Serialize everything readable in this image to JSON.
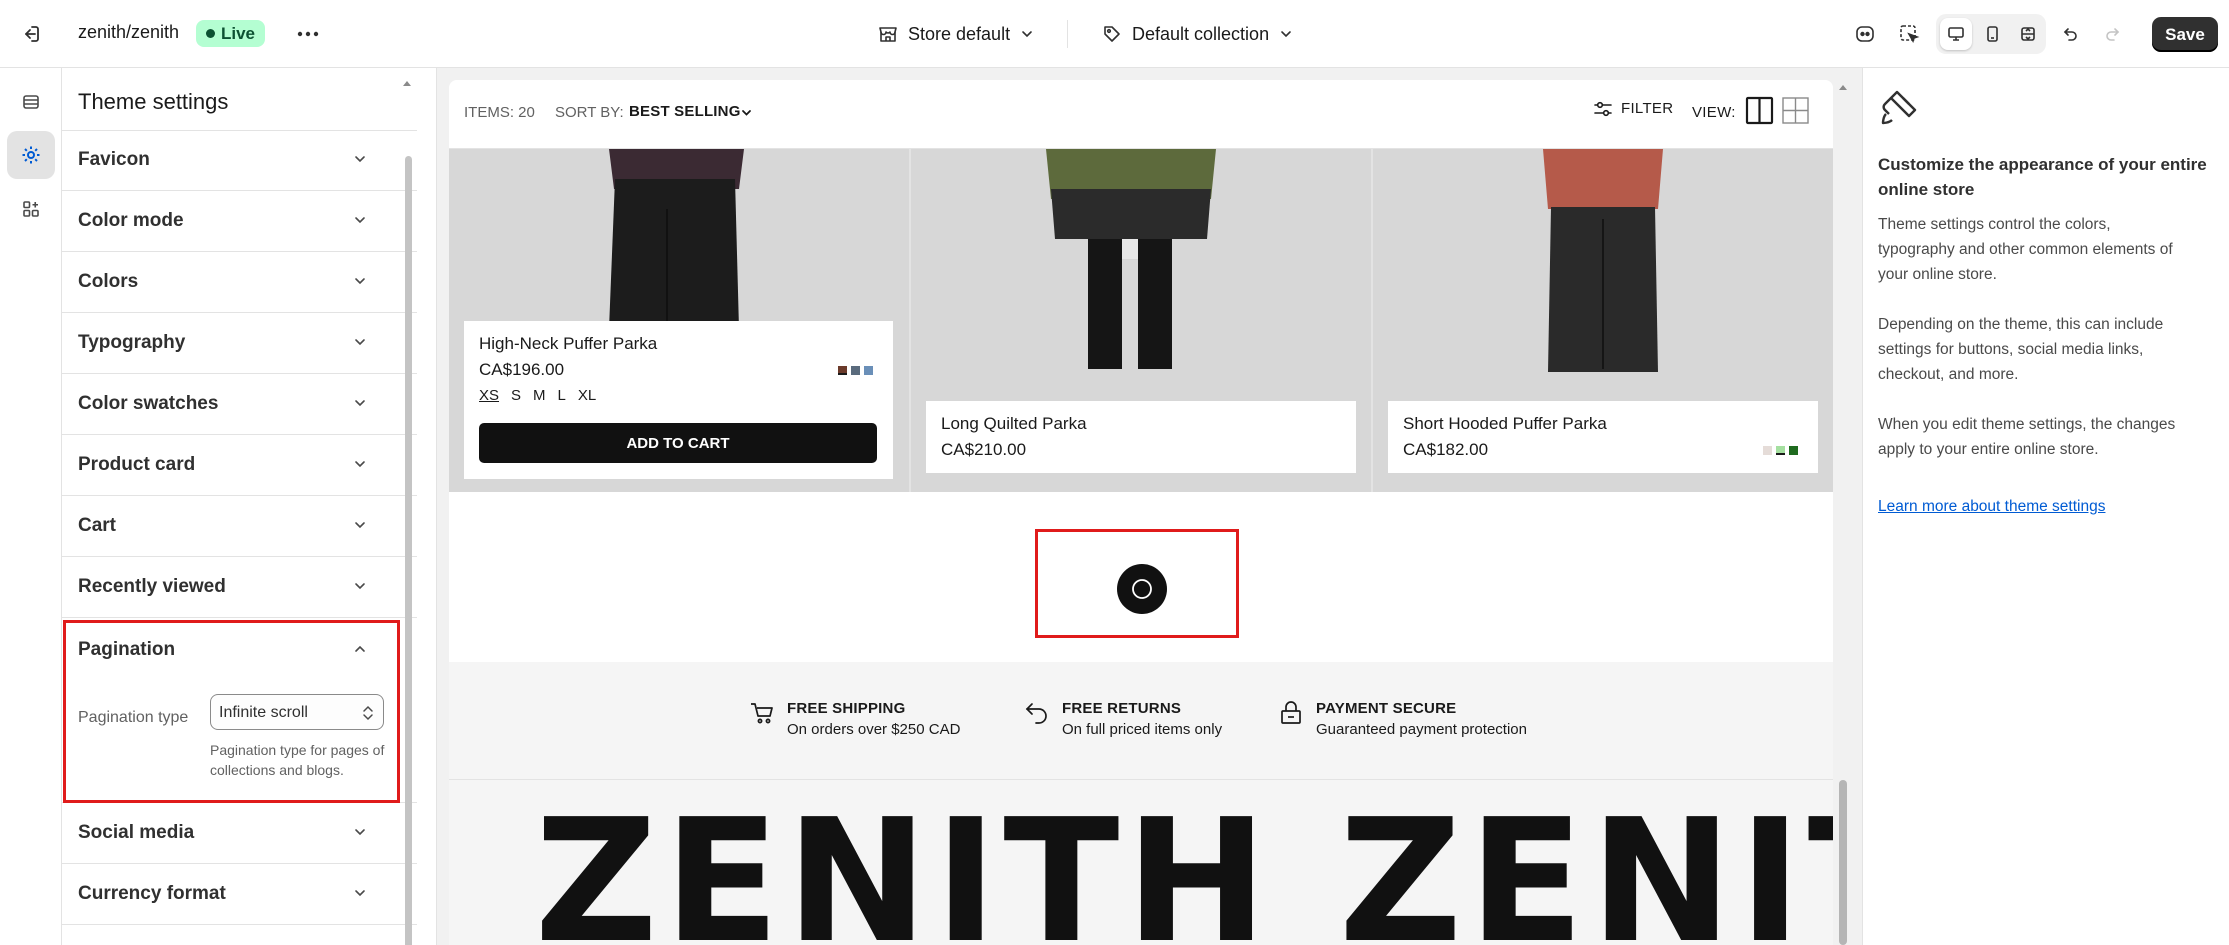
{
  "topbar": {
    "store_name": "zenith/zenith",
    "live_label": "Live",
    "store_select": "Store default",
    "collection_select": "Default collection",
    "save_label": "Save"
  },
  "settings": {
    "title": "Theme settings",
    "sections": [
      {
        "label": "Favicon"
      },
      {
        "label": "Color mode"
      },
      {
        "label": "Colors"
      },
      {
        "label": "Typography"
      },
      {
        "label": "Color swatches"
      },
      {
        "label": "Product card"
      },
      {
        "label": "Cart"
      },
      {
        "label": "Recently viewed"
      }
    ],
    "pagination": {
      "label": "Pagination",
      "type_label": "Pagination type",
      "type_value": "Infinite scroll",
      "help": "Pagination type for pages of collections and blogs."
    },
    "sections_after": [
      {
        "label": "Social media"
      },
      {
        "label": "Currency format"
      }
    ]
  },
  "preview": {
    "toolbar": {
      "items": "ITEMS: 20",
      "sort_label": "SORT BY:",
      "sort_value": "BEST SELLING",
      "filter": "FILTER",
      "view": "VIEW:"
    },
    "products": [
      {
        "name": "High-Neck Puffer Parka",
        "price": "CA$196.00",
        "sizes": [
          "XS",
          "S",
          "M",
          "L",
          "XL"
        ],
        "swatches": [
          "#6b3a2a",
          "#5a6b7d",
          "#6a8fb8"
        ],
        "add_to_cart": "ADD TO CART"
      },
      {
        "name": "Long Quilted Parka",
        "price": "CA$210.00"
      },
      {
        "name": "Short Hooded Puffer Parka",
        "price": "CA$182.00",
        "swatches": [
          "#e5dcd8",
          "#a5e0a0",
          "#1f6b1f"
        ]
      }
    ],
    "features": [
      {
        "title": "FREE SHIPPING",
        "subtitle": "On orders over $250 CAD",
        "icon": "cart-icon"
      },
      {
        "title": "FREE RETURNS",
        "subtitle": "On full priced items only",
        "icon": "return-icon"
      },
      {
        "title": "PAYMENT SECURE",
        "subtitle": "Guaranteed payment protection",
        "icon": "lock-icon"
      }
    ],
    "marquee": "H   ZENITH   ZENITH"
  },
  "right_panel": {
    "heading": "Customize the appearance of your entire online store",
    "p1": "Theme settings control the colors, typography and other common elements of your online store.",
    "p2": "Depending on the theme, this can include settings for buttons, social media links, checkout, and more.",
    "p3": "When you edit theme settings, the changes apply to your entire online store.",
    "link": "Learn more about theme settings"
  },
  "colors": {
    "accent": "#005bd3",
    "live_badge": "#b4fed2",
    "highlight": "#e01b1b"
  }
}
